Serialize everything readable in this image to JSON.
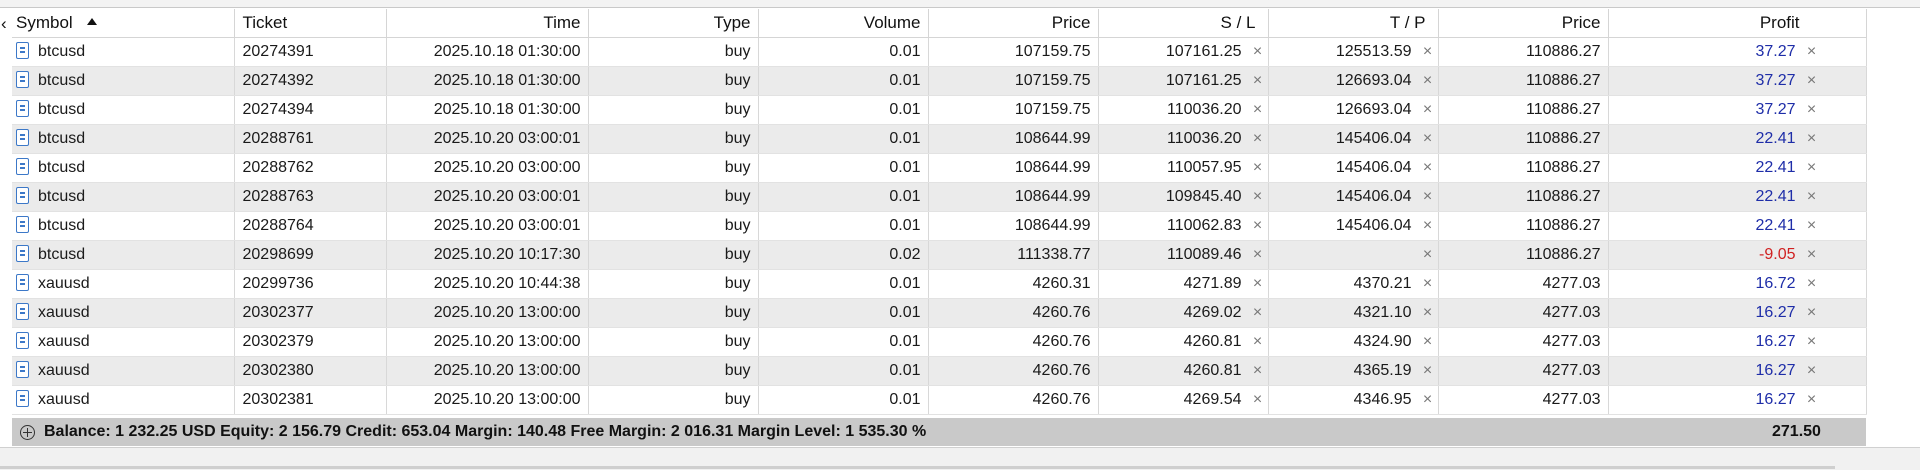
{
  "columns": [
    {
      "key": "symbol",
      "label": "Symbol"
    },
    {
      "key": "ticket",
      "label": "Ticket"
    },
    {
      "key": "time",
      "label": "Time"
    },
    {
      "key": "type",
      "label": "Type"
    },
    {
      "key": "volume",
      "label": "Volume"
    },
    {
      "key": "price",
      "label": "Price"
    },
    {
      "key": "sl",
      "label": "S / L"
    },
    {
      "key": "tp",
      "label": "T / P"
    },
    {
      "key": "cur_price",
      "label": "Price"
    },
    {
      "key": "profit",
      "label": "Profit"
    }
  ],
  "sort": {
    "column": "symbol",
    "direction": "ascending"
  },
  "rows": [
    {
      "symbol": "btcusd",
      "ticket": "20274391",
      "time": "2025.10.18 01:30:00",
      "type": "buy",
      "volume": "0.01",
      "price": "107159.75",
      "sl": "107161.25",
      "tp": "125513.59",
      "cur_price": "110886.27",
      "profit": "37.27"
    },
    {
      "symbol": "btcusd",
      "ticket": "20274392",
      "time": "2025.10.18 01:30:00",
      "type": "buy",
      "volume": "0.01",
      "price": "107159.75",
      "sl": "107161.25",
      "tp": "126693.04",
      "cur_price": "110886.27",
      "profit": "37.27"
    },
    {
      "symbol": "btcusd",
      "ticket": "20274394",
      "time": "2025.10.18 01:30:00",
      "type": "buy",
      "volume": "0.01",
      "price": "107159.75",
      "sl": "110036.20",
      "tp": "126693.04",
      "cur_price": "110886.27",
      "profit": "37.27"
    },
    {
      "symbol": "btcusd",
      "ticket": "20288761",
      "time": "2025.10.20 03:00:01",
      "type": "buy",
      "volume": "0.01",
      "price": "108644.99",
      "sl": "110036.20",
      "tp": "145406.04",
      "cur_price": "110886.27",
      "profit": "22.41"
    },
    {
      "symbol": "btcusd",
      "ticket": "20288762",
      "time": "2025.10.20 03:00:00",
      "type": "buy",
      "volume": "0.01",
      "price": "108644.99",
      "sl": "110057.95",
      "tp": "145406.04",
      "cur_price": "110886.27",
      "profit": "22.41"
    },
    {
      "symbol": "btcusd",
      "ticket": "20288763",
      "time": "2025.10.20 03:00:01",
      "type": "buy",
      "volume": "0.01",
      "price": "108644.99",
      "sl": "109845.40",
      "tp": "145406.04",
      "cur_price": "110886.27",
      "profit": "22.41"
    },
    {
      "symbol": "btcusd",
      "ticket": "20288764",
      "time": "2025.10.20 03:00:01",
      "type": "buy",
      "volume": "0.01",
      "price": "108644.99",
      "sl": "110062.83",
      "tp": "145406.04",
      "cur_price": "110886.27",
      "profit": "22.41"
    },
    {
      "symbol": "btcusd",
      "ticket": "20298699",
      "time": "2025.10.20 10:17:30",
      "type": "buy",
      "volume": "0.02",
      "price": "111338.77",
      "sl": "110089.46",
      "tp": "",
      "cur_price": "110886.27",
      "profit": "-9.05"
    },
    {
      "symbol": "xauusd",
      "ticket": "20299736",
      "time": "2025.10.20 10:44:38",
      "type": "buy",
      "volume": "0.01",
      "price": "4260.31",
      "sl": "4271.89",
      "tp": "4370.21",
      "cur_price": "4277.03",
      "profit": "16.72"
    },
    {
      "symbol": "xauusd",
      "ticket": "20302377",
      "time": "2025.10.20 13:00:00",
      "type": "buy",
      "volume": "0.01",
      "price": "4260.76",
      "sl": "4269.02",
      "tp": "4321.10",
      "cur_price": "4277.03",
      "profit": "16.27"
    },
    {
      "symbol": "xauusd",
      "ticket": "20302379",
      "time": "2025.10.20 13:00:00",
      "type": "buy",
      "volume": "0.01",
      "price": "4260.76",
      "sl": "4260.81",
      "tp": "4324.90",
      "cur_price": "4277.03",
      "profit": "16.27"
    },
    {
      "symbol": "xauusd",
      "ticket": "20302380",
      "time": "2025.10.20 13:00:00",
      "type": "buy",
      "volume": "0.01",
      "price": "4260.76",
      "sl": "4260.81",
      "tp": "4365.19",
      "cur_price": "4277.03",
      "profit": "16.27"
    },
    {
      "symbol": "xauusd",
      "ticket": "20302381",
      "time": "2025.10.20 13:00:00",
      "type": "buy",
      "volume": "0.01",
      "price": "4260.76",
      "sl": "4269.54",
      "tp": "4346.95",
      "cur_price": "4277.03",
      "profit": "16.27"
    }
  ],
  "close_glyph": "×",
  "summary": {
    "text": "Balance: 1 232.25 USD  Equity: 2 156.79  Credit: 653.04  Margin: 140.48  Free Margin: 2 016.31  Margin Level: 1 535.30 %",
    "total_profit": "271.50"
  },
  "colors": {
    "profit_positive": "#1e2da8",
    "profit_negative": "#d02020",
    "alt_row": "#ebebeb",
    "summary_bg": "#c9c9c9",
    "doc_icon": "#3c78c8"
  },
  "icons": {
    "left_scroll": "‹",
    "row_icon": "document-icon",
    "summary_icon": "plus-circle-icon"
  }
}
